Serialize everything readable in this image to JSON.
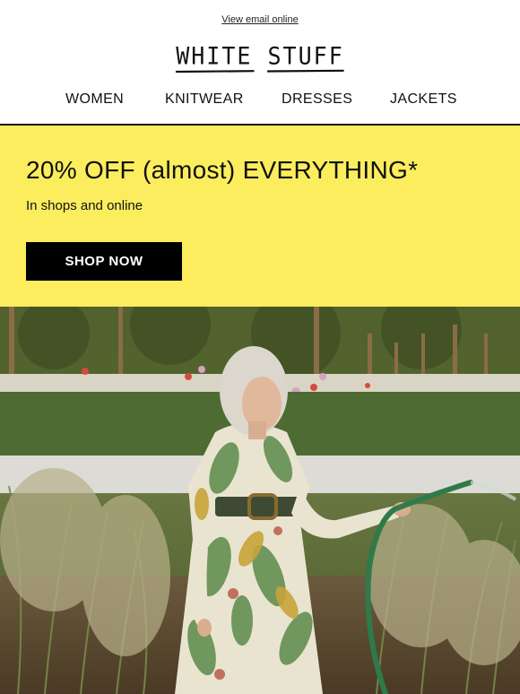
{
  "header": {
    "view_online": "View email online",
    "logo": "WHITE STUFF"
  },
  "nav": {
    "items": [
      "WOMEN",
      "KNITWEAR",
      "DRESSES",
      "JACKETS"
    ]
  },
  "promo": {
    "headline": "20% OFF (almost) EVERYTHING*",
    "subtext": "In shops and online",
    "cta": "SHOP NOW",
    "background_color": "#fbed5d",
    "button_color": "#000000"
  },
  "hero": {
    "icon": "hero-photo"
  }
}
